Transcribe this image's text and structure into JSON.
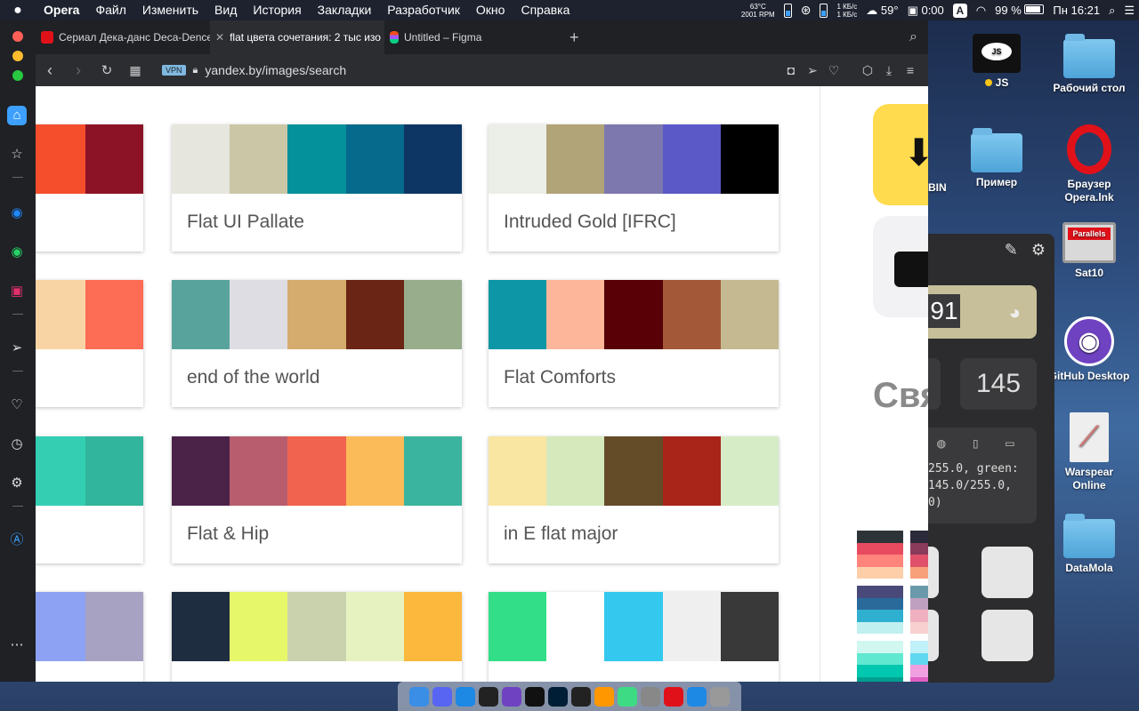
{
  "menubar": {
    "app": "Opera",
    "items": [
      "Файл",
      "Изменить",
      "Вид",
      "История",
      "Закладки",
      "Разработчик",
      "Окно",
      "Справка"
    ],
    "temp_line1": "63°C",
    "temp_line2": "2001 RPM",
    "net_up": "1 КБ/с",
    "net_down": "1 КБ/с",
    "weather": "59°",
    "timer": "0:00",
    "input_letter": "A",
    "battery": "99 %",
    "clock": "Пн 16:21"
  },
  "desktop": {
    "icons": [
      {
        "label": "JS",
        "kind": "js"
      },
      {
        "label": "Рабочий стол",
        "kind": "folder"
      },
      {
        "label": "Пример",
        "kind": "folder"
      },
      {
        "label": "Браузер Opera.lnk",
        "kind": "opera"
      },
      {
        "label": "Sat10",
        "kind": "parallels"
      },
      {
        "label": "GitHub Desktop",
        "kind": "github"
      },
      {
        "label": "Warspear Online",
        "kind": "warspear"
      },
      {
        "label": "DataMola",
        "kind": "folder"
      }
    ],
    "partial_bin_label": "BIN"
  },
  "browser": {
    "tabs": [
      {
        "title": "Сериал Дека-данс Deca-Dence",
        "color": "#e1111a"
      },
      {
        "title": "flat цвета сочетания: 2 тыс изо",
        "color": "#ffffff"
      },
      {
        "title": "Untitled – Figma",
        "color": "#f24e1e"
      }
    ],
    "vpn_label": "VPN",
    "url": "yandex.by/images/search"
  },
  "palettes": [
    {
      "name": "",
      "colors": [
        "#f54e2c",
        "#8c1326"
      ]
    },
    {
      "name": "Flat UI Pallate",
      "colors": [
        "#e6e5de",
        "#cbc6a6",
        "#05919c",
        "#066a8c",
        "#0e3665"
      ]
    },
    {
      "name": "Intruded Gold [IFRC]",
      "colors": [
        "#eceee8",
        "#b1a479",
        "#7d78ad",
        "#5b59c7",
        "#000000"
      ]
    },
    {
      "name": "",
      "colors": [
        "#f8d4a4",
        "#fd6c54"
      ]
    },
    {
      "name": "end of the world",
      "colors": [
        "#58a49c",
        "#dfdde4",
        "#d6ac6e",
        "#6b2514",
        "#98ad8c"
      ]
    },
    {
      "name": "Flat Comforts",
      "colors": [
        "#0d96a5",
        "#fdb69a",
        "#580006",
        "#a35937",
        "#c4b990"
      ]
    },
    {
      "name": "",
      "colors": [
        "#34cfb3",
        "#31b59c"
      ]
    },
    {
      "name": "Flat & Hip",
      "colors": [
        "#4b2248",
        "#b85d6e",
        "#f1634f",
        "#fcbb59",
        "#3ab49e"
      ]
    },
    {
      "name": "in E flat major",
      "colors": [
        "#f8e6a2",
        "#d5e9bc",
        "#654c29",
        "#a92419",
        "#d6ecc6"
      ]
    },
    {
      "name": "",
      "colors": [
        "#8da2f2",
        "#a8a2c2"
      ]
    },
    {
      "name": "",
      "colors": [
        "#1f2d40",
        "#e6f86a",
        "#cad2ad",
        "#e6f2c0",
        "#fbb83c"
      ]
    },
    {
      "name": "",
      "colors": [
        "#33de88",
        "#ffffff",
        "#35c8ee",
        "#efefef",
        "#393939"
      ]
    }
  ],
  "side_panel": {
    "partial_heading": "Свя"
  },
  "picker": {
    "number": "91",
    "value": "145",
    "code_lines": [
      "255.0, green:",
      "145.0/255.0,",
      "0)"
    ]
  },
  "dock": {
    "apps": [
      {
        "name": "finder",
        "color": "#3a8ee6"
      },
      {
        "name": "discord",
        "color": "#5865f2"
      },
      {
        "name": "safari",
        "color": "#1e88e5"
      },
      {
        "name": "intellij",
        "color": "#222222"
      },
      {
        "name": "github",
        "color": "#6f42c1"
      },
      {
        "name": "webstorm",
        "color": "#111111"
      },
      {
        "name": "photoshop",
        "color": "#001e36"
      },
      {
        "name": "terminal",
        "color": "#222222"
      },
      {
        "name": "sublime",
        "color": "#ff9800"
      },
      {
        "name": "android-studio",
        "color": "#3ddc84"
      },
      {
        "name": "system-preferences",
        "color": "#888888"
      },
      {
        "name": "opera",
        "color": "#e1111a"
      },
      {
        "name": "droplet",
        "color": "#1e88e5"
      },
      {
        "name": "trash",
        "color": "#999999"
      }
    ]
  }
}
